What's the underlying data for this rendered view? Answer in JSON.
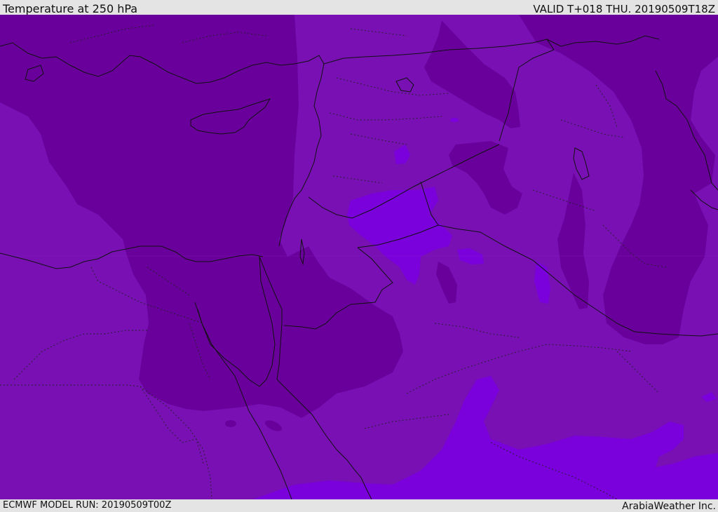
{
  "header": {
    "title": "Temperature at 250 hPa",
    "valid": "VALID T+018 THU. 20190509T18Z"
  },
  "footer": {
    "model_run": "ECMWF MODEL RUN: 20190509T00Z",
    "credit": "ArabiaWeather Inc."
  },
  "colors": {
    "base": "#7810b4",
    "cold": "#6a009c",
    "warm": "#7a00dc",
    "border": "#111111"
  }
}
